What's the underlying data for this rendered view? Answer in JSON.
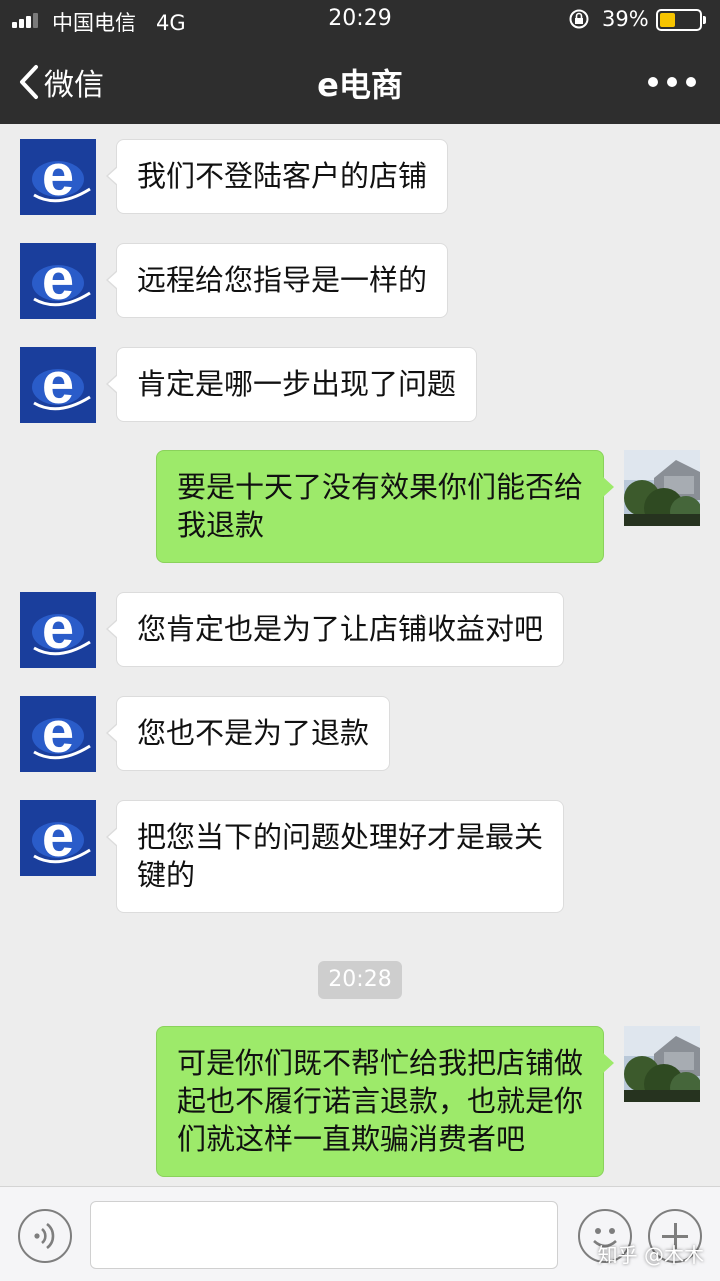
{
  "status_bar": {
    "carrier": "中国电信",
    "network": "4G",
    "time": "20:29",
    "battery_percent": "39%",
    "battery_level": 0.39
  },
  "nav": {
    "back_label": "微信",
    "title": "e电商"
  },
  "messages": [
    {
      "side": "in",
      "text": "我们不登陆客户的店铺"
    },
    {
      "side": "in",
      "text": "远程给您指导是一样的"
    },
    {
      "side": "in",
      "text": "肯定是哪一步出现了问题"
    },
    {
      "side": "out",
      "lines": [
        "要是十天了没有效果你们能否给",
        "我退款"
      ]
    },
    {
      "side": "in",
      "text": "您肯定也是为了让店铺收益对吧"
    },
    {
      "side": "in",
      "text": "您也不是为了退款"
    },
    {
      "side": "in",
      "lines": [
        "把您当下的问题处理好才是最关",
        "键的"
      ]
    },
    {
      "side": "out",
      "lines": [
        "可是你们既不帮忙给我把店铺做",
        "起也不履行诺言退款，也就是你",
        "们就这样一直欺骗消费者吧"
      ]
    }
  ],
  "timestamp": "20:28",
  "watermark": "知乎 @木木",
  "colors": {
    "header_bg": "#2e2e2e",
    "chat_bg": "#ededed",
    "incoming_bubble": "#ffffff",
    "outgoing_bubble": "#9dea6a",
    "avatar_blue": "#1a3e9c"
  },
  "icons": {
    "back": "chevron-left-icon",
    "more": "more-dots-icon",
    "voice": "voice-icon",
    "emoji": "emoji-icon",
    "plus": "plus-icon",
    "avatar_in": "e-logo-avatar",
    "avatar_out": "photo-avatar"
  }
}
